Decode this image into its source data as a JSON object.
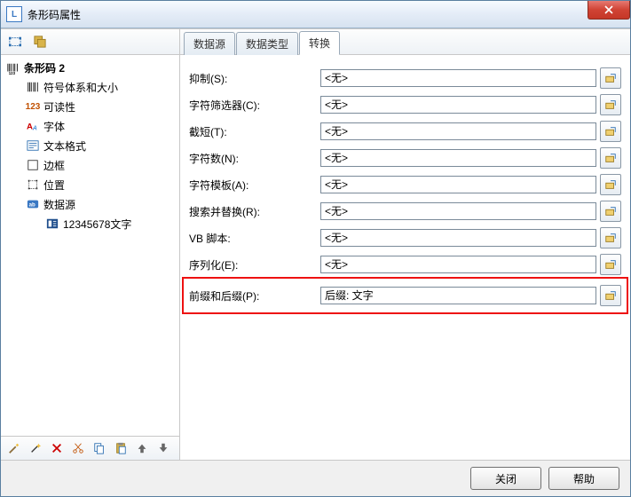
{
  "window": {
    "title": "条形码属性"
  },
  "left_toolbar": {
    "btn1_name": "toolbar-icon-a",
    "btn2_name": "toolbar-icon-b"
  },
  "tree": {
    "root_label": "条形码 2",
    "items": [
      {
        "icon": "barcode",
        "label": "符号体系和大小"
      },
      {
        "icon": "num",
        "label": "可读性",
        "icon_text": "123"
      },
      {
        "icon": "font",
        "label": "字体"
      },
      {
        "icon": "textfmt",
        "label": "文本格式"
      },
      {
        "icon": "border",
        "label": "边框"
      },
      {
        "icon": "pos",
        "label": "位置"
      },
      {
        "icon": "datasrc",
        "label": "数据源"
      }
    ],
    "sub": {
      "icon": "field",
      "label": "12345678文字"
    }
  },
  "bottom_toolbar": {
    "items": [
      "wizard",
      "magic",
      "delete",
      "cut",
      "copy",
      "paste",
      "up",
      "down"
    ]
  },
  "tabs": [
    {
      "id": "datasource",
      "label": "数据源",
      "active": false
    },
    {
      "id": "datatype",
      "label": "数据类型",
      "active": false
    },
    {
      "id": "transform",
      "label": "转换",
      "active": true
    }
  ],
  "form": {
    "placeholder_none": "<无>",
    "rows": [
      {
        "key": "suppress",
        "label": "抑制(S):",
        "value": "<无>"
      },
      {
        "key": "charfilter",
        "label": "字符筛选器(C):",
        "value": "<无>"
      },
      {
        "key": "truncate",
        "label": "截短(T):",
        "value": "<无>"
      },
      {
        "key": "charcount",
        "label": "字符数(N):",
        "value": "<无>"
      },
      {
        "key": "chartmpl",
        "label": "字符模板(A):",
        "value": "<无>"
      },
      {
        "key": "searchrep",
        "label": "搜索并替换(R):",
        "value": "<无>"
      },
      {
        "key": "vbscript",
        "label": "VB 脚本:",
        "value": "<无>"
      },
      {
        "key": "serialize",
        "label": "序列化(E):",
        "value": "<无>"
      },
      {
        "key": "prefixsfx",
        "label": "前缀和后缀(P):",
        "value": "后缀: 文字",
        "highlight": true
      }
    ]
  },
  "footer": {
    "close": "关闭",
    "help": "帮助"
  }
}
